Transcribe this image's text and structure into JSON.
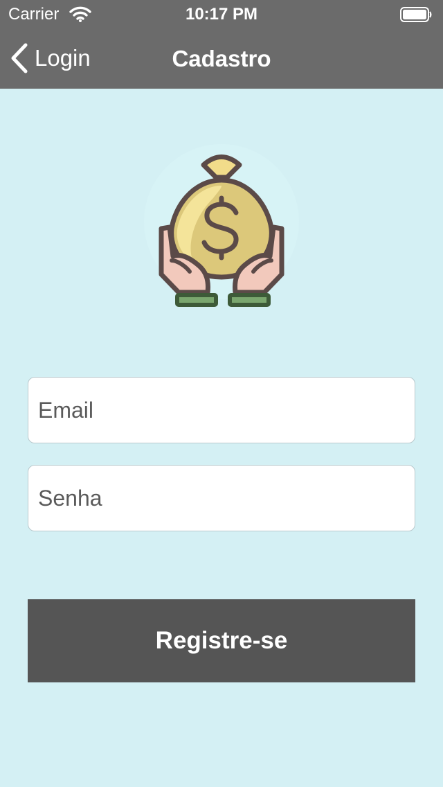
{
  "status_bar": {
    "carrier": "Carrier",
    "time": "10:17 PM",
    "icons": [
      "wifi-icon",
      "battery-icon"
    ]
  },
  "nav": {
    "back_label": "Login",
    "title": "Cadastro"
  },
  "hero": {
    "icon": "money-bag-in-hands-icon"
  },
  "form": {
    "email_placeholder": "Email",
    "password_placeholder": "Senha",
    "submit_label": "Registre-se"
  },
  "colors": {
    "background": "#d4f0f4",
    "nav_bar": "#6b6b6b",
    "button": "#555555",
    "bag": "#f2dc8a",
    "outline": "#5b4a48",
    "skin": "#f2c9bc",
    "cuff": "#7aa66e"
  }
}
